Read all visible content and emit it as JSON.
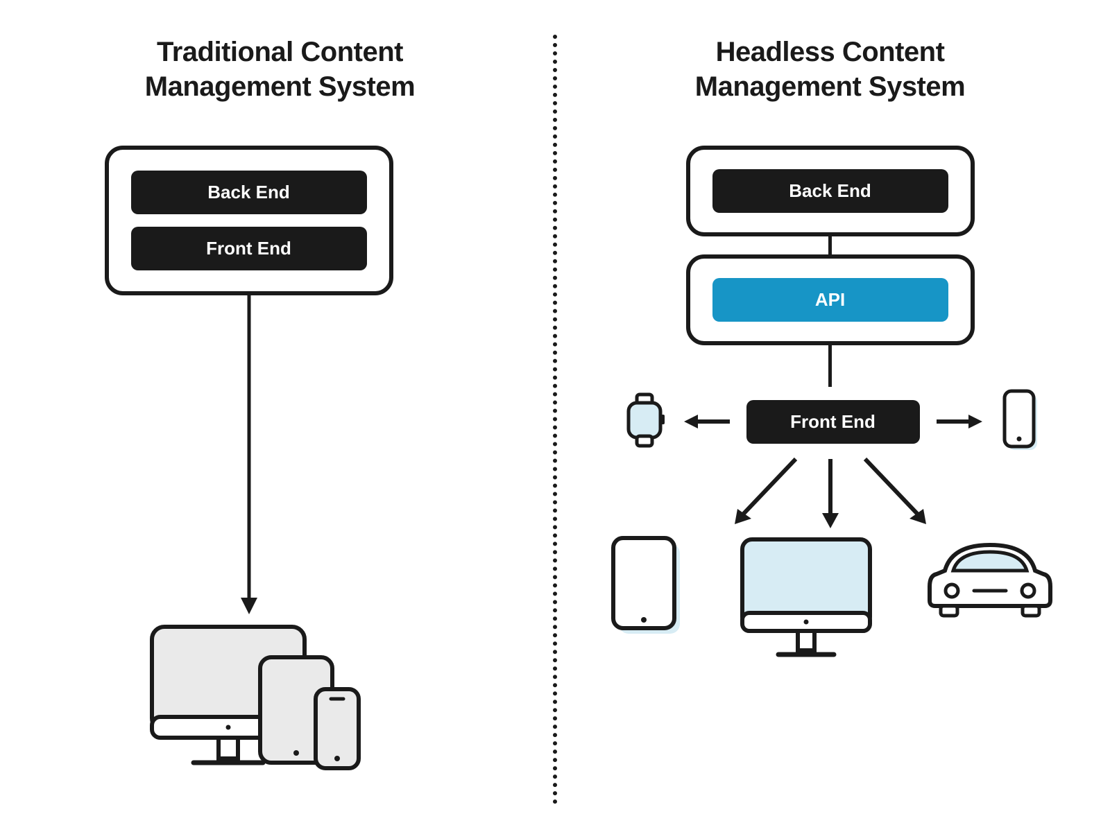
{
  "left": {
    "title_line1": "Traditional Content",
    "title_line2": "Management System",
    "back_end": "Back End",
    "front_end": "Front End"
  },
  "right": {
    "title_line1": "Headless Content",
    "title_line2": "Management System",
    "back_end": "Back End",
    "api": "API",
    "front_end": "Front End"
  },
  "colors": {
    "ink": "#1a1a1a",
    "accent_blue": "#1795c6",
    "pale_blue": "#d7ecf4",
    "pale_grey": "#eaeaea"
  }
}
